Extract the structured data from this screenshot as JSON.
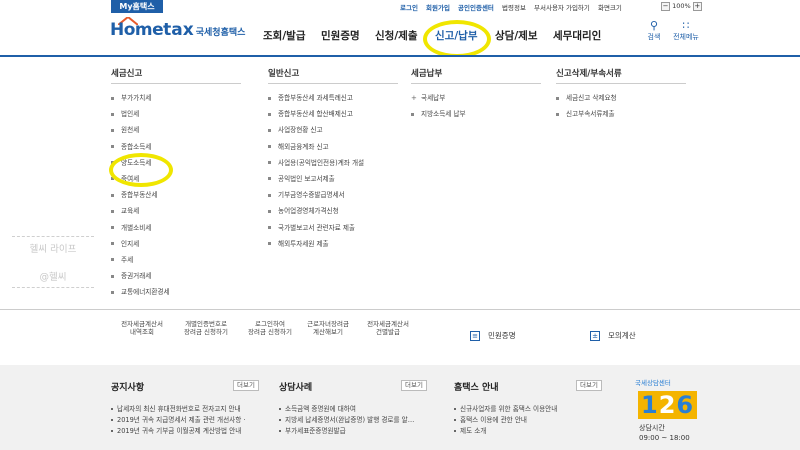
{
  "topbar": {
    "my_tab": "My홈택스",
    "links": [
      "로그인",
      "회원가입",
      "공인인증센터",
      "법령정보",
      "부서사용자 가입하기",
      "화면크기"
    ],
    "zoom_minus": "−",
    "zoom_value": "100%",
    "zoom_plus": "+"
  },
  "header": {
    "logo_home": "Home",
    "logo_tax": "tax",
    "logo_sub": "국세청홈택스",
    "gnb": [
      "조회/발급",
      "민원증명",
      "신청/제출",
      "신고/납부",
      "상담/제보",
      "세무대리인"
    ],
    "search_label": "검색",
    "allmenu_label": "전체메뉴"
  },
  "menu": {
    "columns": [
      {
        "title": "세금신고",
        "items": [
          "부가가치세",
          "법인세",
          "원천세",
          "종합소득세",
          "양도소득세",
          "증여세",
          "종합부동산세",
          "교육세",
          "개별소비세",
          "인지세",
          "주세",
          "증권거래세",
          "교통에너지환경세"
        ]
      },
      {
        "title": "일반신고",
        "items": [
          "종합부동산세 과세특례신고",
          "종합부동산세 합산배제신고",
          "사업장현황 신고",
          "해외금융계좌 신고",
          "사업용(공익법인전용)계좌 개설",
          "공익법인 보고서제출",
          "기부금영수증발급명세서",
          "농어업경영체가격신청",
          "국가별보고서 관련자료 제출",
          "해외투자세원 제출"
        ]
      },
      {
        "title": "세금납부",
        "items": [
          "국세납부",
          "지방소득세 납부"
        ]
      },
      {
        "title": "신고삭제/부속서류",
        "items": [
          "세금신고 삭제요청",
          "신고부속서류제출"
        ]
      }
    ]
  },
  "watermark": {
    "line1": "헬씨 라이프",
    "line2": "@헬씨"
  },
  "quick": [
    "전자세금계산서\n내역조회",
    "개별인증번호로\n장려금 신청하기",
    "로그인하여\n장려금 신청하기",
    "근로자녀장려금\n계산해보기",
    "전자세금계산서\n건별발급"
  ],
  "services": {
    "left": "민원증명",
    "right": "모의계산"
  },
  "footer": {
    "notice": {
      "title": "공지사항",
      "more": "더보기",
      "items": [
        "납세자의 최신 휴대전화번호로 전자고지 안내",
        "2019년 귀속 지급명세서 제출 관련 개선사항 ·",
        "2019년 귀속 기부금 이월공제 계산방법 안내"
      ]
    },
    "cases": {
      "title": "상담사례",
      "more": "더보기",
      "items": [
        "소득금액 증명원에 대하여",
        "지방세 납세증명서(완납증명) 발행 경로를 알…",
        "부가세표준증명원발급"
      ]
    },
    "guide": {
      "title": "홈택스 안내",
      "more": "더보기",
      "items": [
        "신규사업자를 위한 홈택스 이용안내",
        "홈택스 이용에 관한 안내",
        "제도 소개"
      ]
    },
    "call": {
      "tag": "국세상담센터",
      "num_a": "1",
      "num_b": "2",
      "num_c": "6",
      "hours_label": "상담시간",
      "hours": "09:00 ~ 18:00"
    }
  }
}
